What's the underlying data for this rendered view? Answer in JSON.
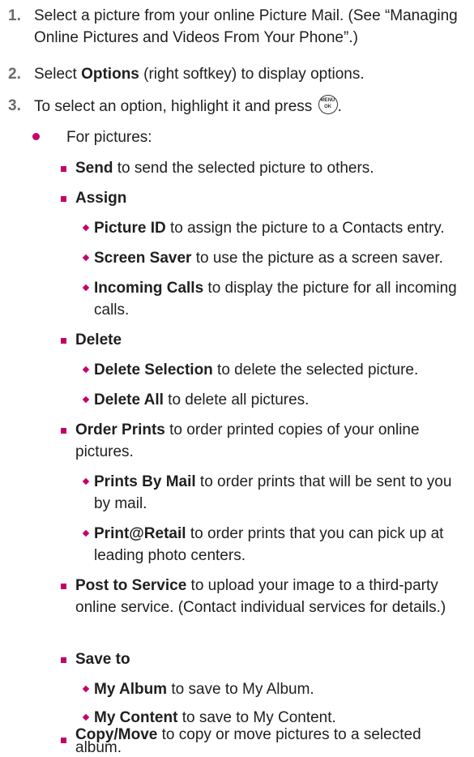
{
  "steps": [
    {
      "num": "1.",
      "text": "Select a picture from your online Picture Mail. (See “Managing Online Pictures and Videos From Your Phone”.)"
    },
    {
      "num": "2.",
      "pre": "Select ",
      "bold": "Options",
      "post": " (right softkey) to display options."
    },
    {
      "num": "3.",
      "pre": "To select an option, highlight it and press ",
      "post": "."
    }
  ],
  "menu_key": {
    "top": "MENU",
    "bottom": "OK",
    "icon": "menu-ok-key-icon"
  },
  "for_pictures": "For pictures:",
  "items": {
    "send": {
      "bold": "Send",
      "text": " to send the selected picture to others."
    },
    "assign": {
      "bold": "Assign"
    },
    "picture_id": {
      "bold": "Picture ID",
      "text": "  to assign the picture to a Contacts entry."
    },
    "screen_saver": {
      "bold": "Screen Saver",
      "text": "  to use the picture as a screen saver."
    },
    "incoming_calls": {
      "bold": "Incoming Calls",
      "text": "  to display the picture for all incoming calls."
    },
    "delete": {
      "bold": "Delete"
    },
    "delete_selection": {
      "bold": "Delete Selection",
      "text": " to delete the selected picture."
    },
    "delete_all": {
      "bold": "Delete All",
      "text": " to delete all pictures."
    },
    "order_prints": {
      "bold": "Order Prints",
      "text": " to order printed copies of your online pictures."
    },
    "prints_by_mail": {
      "bold": "Prints By Mail",
      "text": " to order prints that will be sent to you by mail."
    },
    "print_retail": {
      "bold": "Print@Retail",
      "text": " to order prints that you can pick up at leading photo centers."
    },
    "post_to_service": {
      "bold": "Post to Service",
      "text": " to upload your image to a third-party online service. (Contact individual services for details.)"
    },
    "save_to": {
      "bold": "Save to"
    },
    "my_album": {
      "bold": "My Album",
      "text": " to save to My Album."
    },
    "my_content": {
      "bold": "My Content",
      "text": "  to save to My Content."
    },
    "copy_move": {
      "bold": "Copy/Move",
      "text": "  to copy or move pictures to a selected album."
    }
  },
  "colors": {
    "bullet": "#c3006b",
    "number": "#6a6a6a",
    "text": "#1f1f1f"
  }
}
